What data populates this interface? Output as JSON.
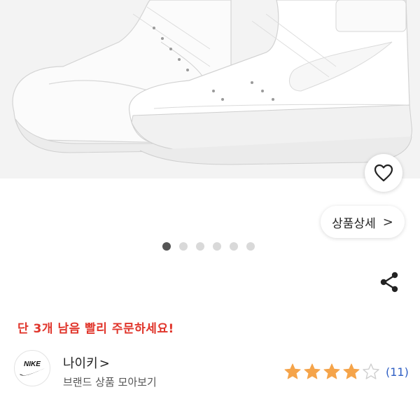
{
  "colors": {
    "alert": "#e0352b",
    "star": "#f5a44a",
    "link": "#2f5fc4",
    "dot_active": "#555555",
    "dot": "#d9d9d9"
  },
  "hero": {
    "image": "white-high-top-sneakers"
  },
  "favorite": {
    "icon": "heart-outline-icon"
  },
  "detail_button": {
    "label": "상품상세",
    "chevron": ">"
  },
  "carousel": {
    "total": 6,
    "active_index": 1
  },
  "share": {
    "icon": "share-icon"
  },
  "stock_alert": "단 3개 남음 빨리 주문하세요!",
  "brand": {
    "logo_text": "NIKE",
    "name": "나이키",
    "name_chevron": ">",
    "more_label": "브랜드 상품 모아보기"
  },
  "rating": {
    "stars_filled": 4,
    "stars_total": 5,
    "review_count": "(11)"
  }
}
